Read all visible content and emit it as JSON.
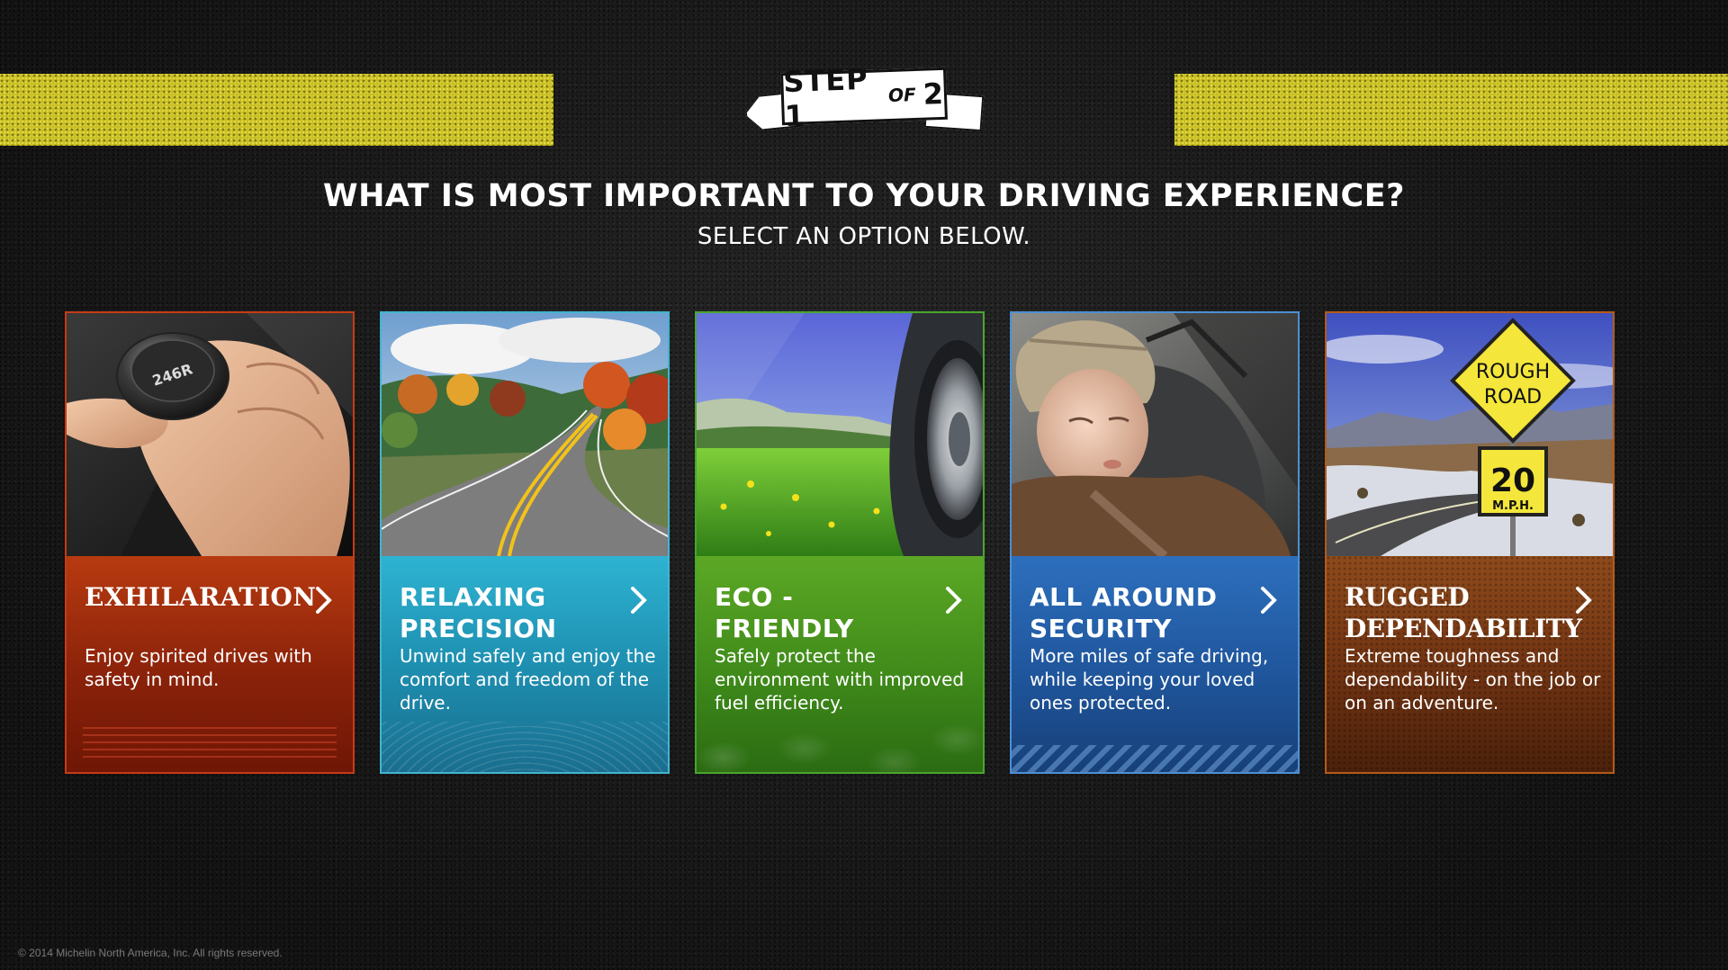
{
  "step": {
    "step_text": "STEP 1",
    "of_text": "OF",
    "total_text": "2"
  },
  "heading": "WHAT IS MOST IMPORTANT TO YOUR DRIVING EXPERIENCE?",
  "subheading": "SELECT AN OPTION BELOW.",
  "options": [
    {
      "title": "EXHILARATION",
      "description": "Enjoy spirited drives with safety in mind.",
      "accent": "#c63b16",
      "icon": "chevron-right-icon"
    },
    {
      "title": "RELAXING PRECISION",
      "description": "Unwind safely and enjoy the comfort and freedom of the drive.",
      "accent": "#42b4cf",
      "icon": "chevron-right-icon"
    },
    {
      "title": "ECO - FRIENDLY",
      "description": "Safely protect the environment with improved fuel efficiency.",
      "accent": "#4aa52e",
      "icon": "chevron-right-icon"
    },
    {
      "title": "ALL AROUND SECURITY",
      "description": "More miles of safe driving, while keeping your loved ones protected.",
      "accent": "#4d8fd2",
      "icon": "chevron-right-icon"
    },
    {
      "title": "RUGGED DEPENDABILITY",
      "description": "Extreme toughness and dependability - on the job or on an adventure.",
      "accent": "#b45a1a",
      "icon": "chevron-right-icon"
    }
  ],
  "photos": {
    "gear_knob_text": "246R",
    "sign_top_line1": "ROUGH",
    "sign_top_line2": "ROAD",
    "sign_speed": "20",
    "sign_unit": "M.P.H."
  },
  "footer": "© 2014 Michelin North America, Inc. All rights reserved."
}
